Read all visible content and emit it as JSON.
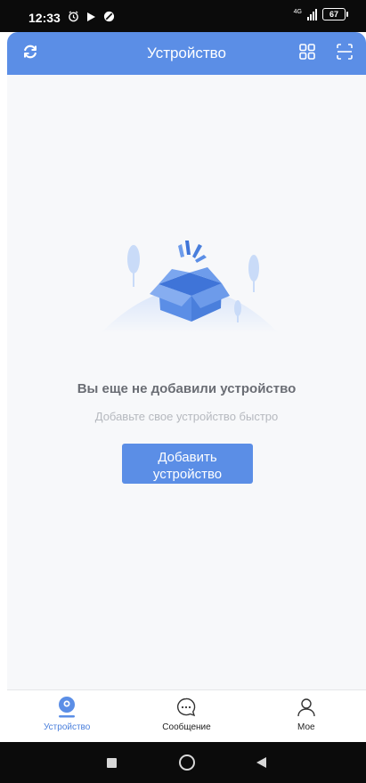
{
  "status_bar": {
    "time": "12:33",
    "icons": [
      "alarm-icon",
      "play-icon",
      "no-disturb-icon"
    ],
    "network": "4G",
    "battery": "67"
  },
  "header": {
    "title": "Устройство",
    "left_icon": "refresh-icon",
    "right_icons": [
      "grid-icon",
      "scan-icon"
    ]
  },
  "empty_state": {
    "title": "Вы еще не добавили устройство",
    "subtitle": "Добавьте свое устройство быстро",
    "button_label": "Добавить устройство"
  },
  "tabs": [
    {
      "label": "Устройство",
      "icon": "camera-icon",
      "active": true
    },
    {
      "label": "Сообщение",
      "icon": "message-icon",
      "active": false
    },
    {
      "label": "Мое",
      "icon": "profile-icon",
      "active": false
    }
  ],
  "colors": {
    "accent": "#5b8ee6",
    "active_tab": "#4a7fdc",
    "background": "#f7f8fa"
  }
}
